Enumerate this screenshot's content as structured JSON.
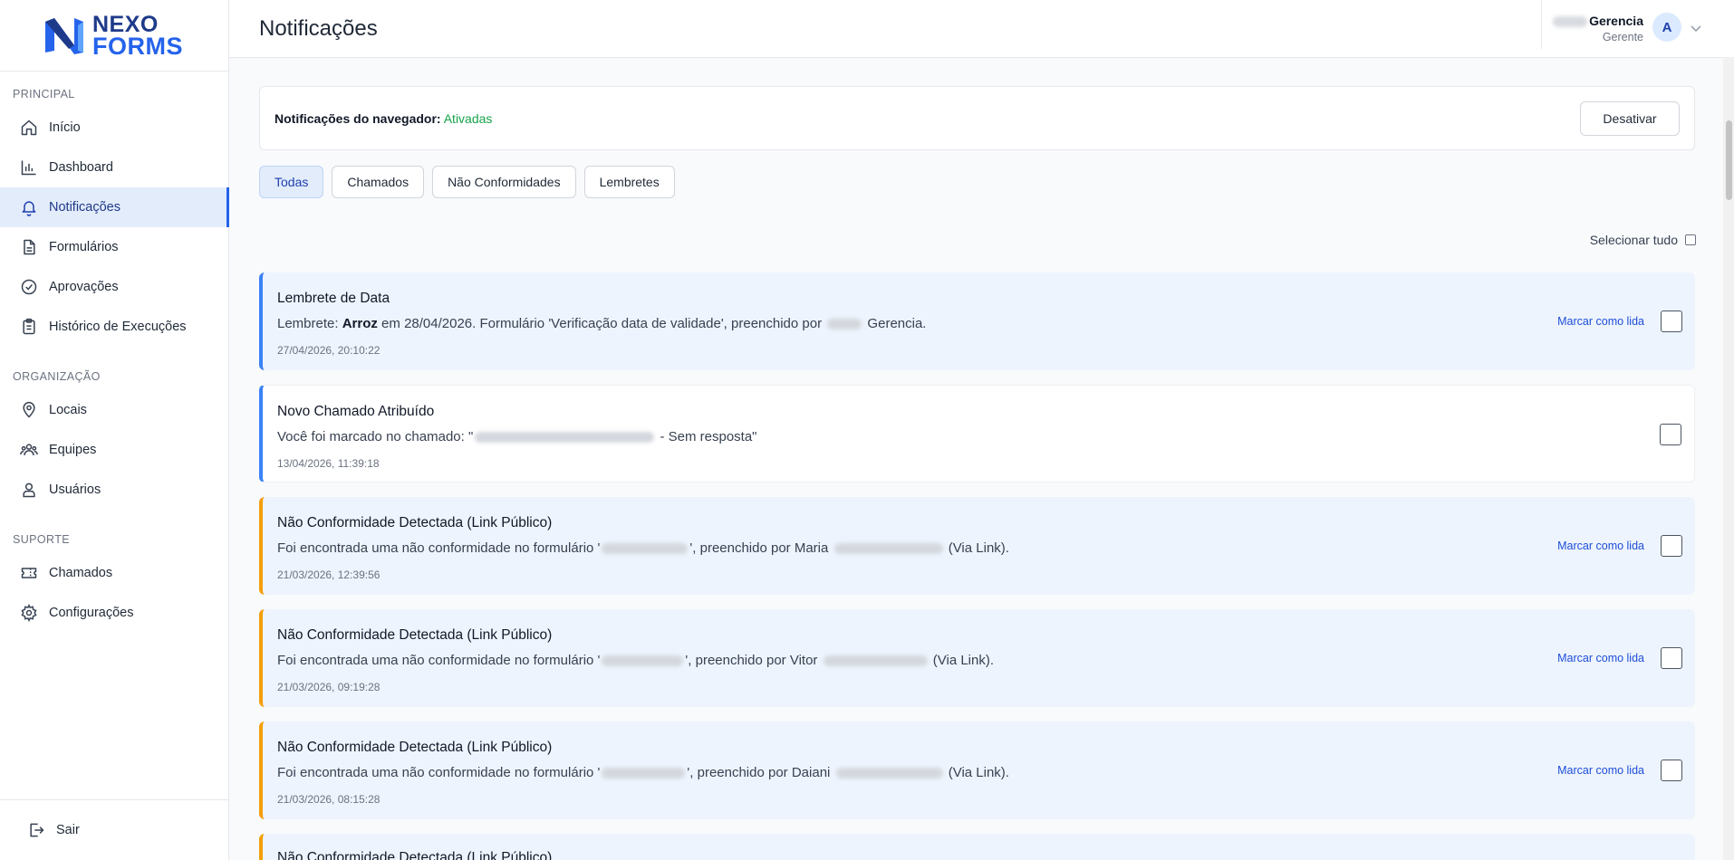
{
  "app": {
    "logo_line1": "NEXO",
    "logo_line2": "FORMS",
    "brand_colors": {
      "primary": "#1e3a8a",
      "accent": "#2563eb"
    }
  },
  "sidebar": {
    "sections": [
      {
        "label": "PRINCIPAL"
      },
      {
        "label": "ORGANIZAÇÃO"
      },
      {
        "label": "SUPORTE"
      }
    ],
    "items": [
      {
        "label": "Início",
        "icon": "home-icon"
      },
      {
        "label": "Dashboard",
        "icon": "chart-icon"
      },
      {
        "label": "Notificações",
        "icon": "bell-icon",
        "active": true
      },
      {
        "label": "Formulários",
        "icon": "document-icon"
      },
      {
        "label": "Aprovações",
        "icon": "check-circle-icon"
      },
      {
        "label": "Histórico de Execuções",
        "icon": "clipboard-icon"
      },
      {
        "label": "Locais",
        "icon": "map-pin-icon"
      },
      {
        "label": "Equipes",
        "icon": "team-icon"
      },
      {
        "label": "Usuários",
        "icon": "users-icon"
      },
      {
        "label": "Chamados",
        "icon": "ticket-icon"
      },
      {
        "label": "Configurações",
        "icon": "gear-icon"
      }
    ],
    "logout_label": "Sair"
  },
  "header": {
    "title": "Notificações",
    "user": {
      "name": "Gerencia",
      "role": "Gerente",
      "avatar_letter": "A"
    }
  },
  "browser_notifications": {
    "label": "Notificações do navegador:",
    "status": "Ativadas",
    "button": "Desativar"
  },
  "tabs": [
    {
      "label": "Todas",
      "active": true
    },
    {
      "label": "Chamados"
    },
    {
      "label": "Não Conformidades"
    },
    {
      "label": "Lembretes"
    }
  ],
  "select_all_label": "Selecionar tudo",
  "mark_read_label": "Marcar como lida",
  "notifications": [
    {
      "title": "Lembrete de Data",
      "msg_pre": "Lembrete: ",
      "msg_bold": "Arroz",
      "msg_mid": " em 28/04/2026. Formulário 'Verificação data de validade', preenchido por ",
      "msg_post": " Gerencia.",
      "time": "27/04/2026, 20:10:22",
      "read": false,
      "kind": "lembrete"
    },
    {
      "title": "Novo Chamado Atribuído",
      "msg_pre": "Você foi marcado no chamado: \"",
      "msg_post": " - Sem resposta\"",
      "time": "13/04/2026, 11:39:18",
      "read": true,
      "kind": "chamado"
    },
    {
      "title": "Não Conformidade Detectada (Link Público)",
      "msg_pre": "Foi encontrada uma não conformidade no formulário '",
      "msg_mid": "', preenchido por Maria ",
      "msg_post": " (Via Link).",
      "time": "21/03/2026, 12:39:56",
      "read": false,
      "kind": "nc"
    },
    {
      "title": "Não Conformidade Detectada (Link Público)",
      "msg_pre": "Foi encontrada uma não conformidade no formulário '",
      "msg_mid": "', preenchido por Vitor ",
      "msg_post": " (Via Link).",
      "time": "21/03/2026, 09:19:28",
      "read": false,
      "kind": "nc"
    },
    {
      "title": "Não Conformidade Detectada (Link Público)",
      "msg_pre": "Foi encontrada uma não conformidade no formulário '",
      "msg_mid": "', preenchido por Daiani ",
      "msg_post": " (Via Link).",
      "time": "21/03/2026, 08:15:28",
      "read": false,
      "kind": "nc"
    },
    {
      "title": "Não Conformidade Detectada (Link Público)",
      "read": false,
      "kind": "nc"
    }
  ]
}
